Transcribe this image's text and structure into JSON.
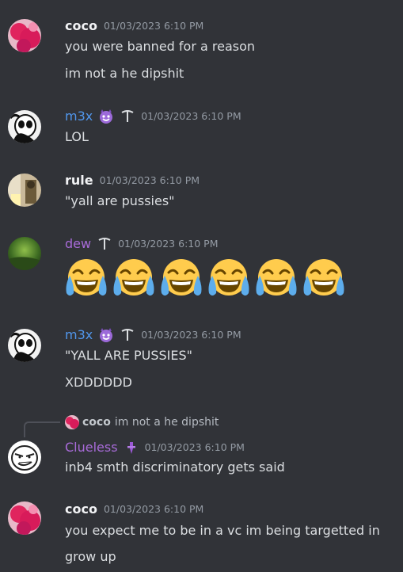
{
  "messages": [
    {
      "author": "coco",
      "timestamp": "01/03/2023 6:10 PM",
      "lines": [
        "you were banned for a reason",
        "im not a he dipshit"
      ]
    },
    {
      "author": "m3x",
      "timestamp": "01/03/2023 6:10 PM",
      "lines": [
        "LOL"
      ]
    },
    {
      "author": "rule",
      "timestamp": "01/03/2023 6:10 PM",
      "lines": [
        "\"yall are pussies\""
      ]
    },
    {
      "author": "dew",
      "timestamp": "01/03/2023 6:10 PM",
      "emoji_count": 6,
      "emoji": "joy-emoji"
    },
    {
      "author": "m3x",
      "timestamp": "01/03/2023 6:10 PM",
      "lines": [
        "\"YALL ARE PUSSIES\"",
        "XDDDDDD"
      ]
    },
    {
      "author": "Clueless",
      "timestamp": "01/03/2023 6:10 PM",
      "reply": {
        "author": "coco",
        "text": "im not a he dipshit"
      },
      "lines": [
        "inb4 smth discriminatory gets said"
      ]
    },
    {
      "author": "coco",
      "timestamp": "01/03/2023 6:10 PM",
      "lines": [
        "you expect me to be in a vc im being targetted in",
        "grow up"
      ]
    }
  ],
  "colors": {
    "background": "#313338",
    "role_blue": "#5197ed",
    "role_purple": "#a86bd9",
    "timestamp": "#949ba4"
  }
}
